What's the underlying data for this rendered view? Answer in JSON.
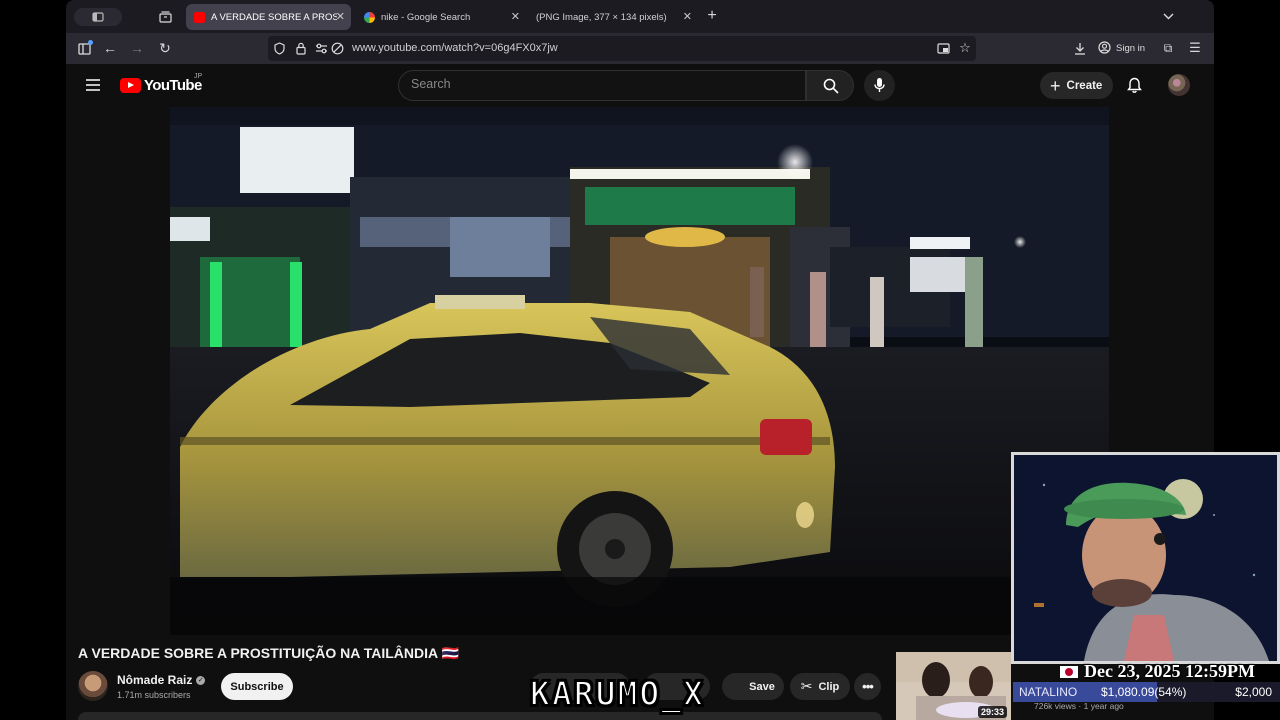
{
  "browser": {
    "tabs": [
      {
        "title": "A VERDADE SOBRE A PROSTITUIÇÃO NA TAILÂNDIA",
        "favicon": "youtube-icon",
        "active": true
      },
      {
        "title": "nike - Google Search",
        "favicon": "google-icon",
        "active": false
      },
      {
        "title": "(PNG Image, 377 × 134 pixels)",
        "favicon": "",
        "active": false
      }
    ],
    "url": "www.youtube.com/watch?v=06g4FX0x7jw",
    "sign_in_label": "Sign in"
  },
  "youtube": {
    "logo_text": "YouTube",
    "region": "JP",
    "search_placeholder": "Search",
    "create_label": "Create"
  },
  "video": {
    "title": "A VERDADE SOBRE A PROSTITUIÇÃO NA TAILÂNDIA 🇹🇭",
    "channel_name": "Nômade Raiz",
    "subscribers": "1.71m subscribers",
    "subscribe_label": "Subscribe",
    "save_label": "Save",
    "clip_label": "Clip"
  },
  "recommended": {
    "duration": "29:33",
    "meta": "726k views · 1 year ago"
  },
  "overlay": {
    "watermark": "KARUMO_X",
    "datetime": "Dec 23, 2025 12:59PM",
    "goal_name": "NATALINO",
    "goal_current": "$1,080.09",
    "goal_percent_text": "(54%)",
    "goal_percent": 54,
    "goal_target": "$2,000"
  },
  "colors": {
    "youtube_red": "#ff0000",
    "browser_tabbar": "#1c1b22",
    "browser_toolbar": "#2b2a33",
    "page_bg": "#0f0f0f",
    "taxi_yellow": "#c9b64a"
  }
}
